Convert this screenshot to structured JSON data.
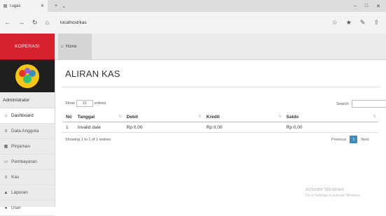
{
  "browser": {
    "tab_title": "Tugas",
    "url": "localhost/kas",
    "nav_icons": [
      "←",
      "→",
      "↻",
      "⌂"
    ],
    "toolbar_icons": [
      "☆",
      "★",
      "✎",
      "⇧"
    ],
    "window_controls": [
      "–",
      "□",
      "✕"
    ]
  },
  "sidebar": {
    "brand": "KOPERASI",
    "section_label": "Administrator",
    "items": [
      {
        "icon": "home-icon",
        "glyph": "⌂",
        "label": "Dashboard"
      },
      {
        "icon": "list-icon",
        "glyph": "≡",
        "label": "Data Anggota"
      },
      {
        "icon": "table-icon",
        "glyph": "▦",
        "label": "Pinjaman"
      },
      {
        "icon": "card-icon",
        "glyph": "▭",
        "label": "Pembayaran"
      },
      {
        "icon": "kas-icon",
        "glyph": "≡",
        "label": "Kas"
      },
      {
        "icon": "chart-icon",
        "glyph": "▲",
        "label": "Laporan"
      },
      {
        "icon": "user-icon",
        "glyph": "●",
        "label": "User"
      }
    ]
  },
  "topbar": {
    "home_label": "Home"
  },
  "main": {
    "title": "ALIRAN KAS",
    "show_label": "Show",
    "entries_value": "10",
    "entries_label": "entries",
    "search_label": "Search:",
    "search_value": "",
    "table": {
      "columns": [
        "No",
        "Tanggal",
        "Debit",
        "Kredit",
        "Saldo"
      ],
      "rows": [
        [
          "1",
          "Invalid date",
          "Rp 0,00",
          "Rp 0,00",
          "Rp 0,00"
        ]
      ]
    },
    "info": "Showing 1 to 1 of 1 entries",
    "pager": {
      "prev": "Previous",
      "current": "1",
      "next": "Next"
    }
  },
  "watermark": {
    "line1": "Activate Windows",
    "line2": "Go to Settings to activate Windows."
  },
  "colors": {
    "brand": "#d6222e",
    "sidebar_bg": "#ebebeb",
    "accent": "#3c8dbc"
  }
}
